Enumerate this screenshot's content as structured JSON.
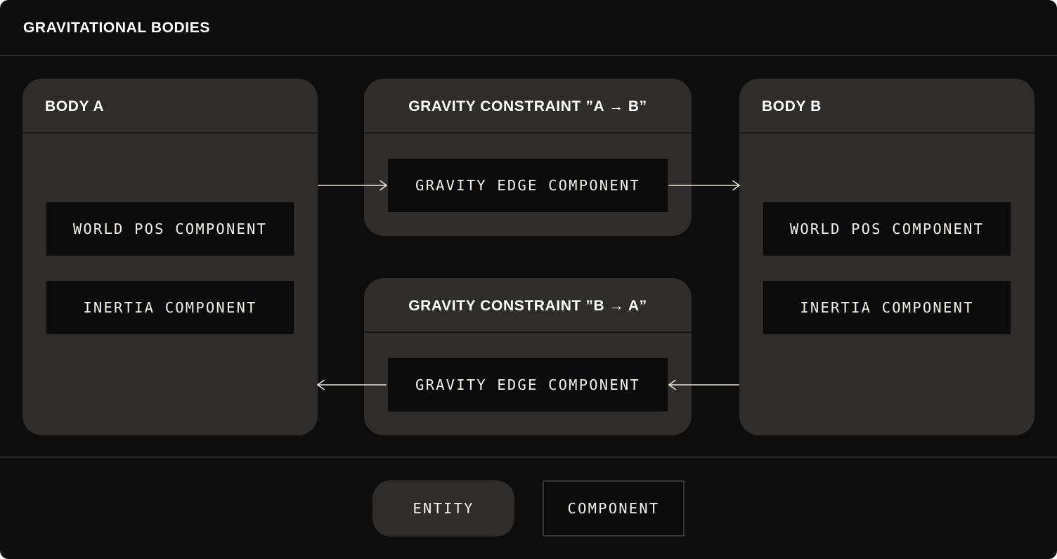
{
  "title": "GRAVITATIONAL BODIES",
  "colors": {
    "background": "#0d0d0d",
    "entity_fill": "#2e2d2c",
    "component_fill": "#0b0b0b",
    "text": "#f4f0e8",
    "arrow": "#ece4d6"
  },
  "entities": {
    "body_a": {
      "title": "BODY A",
      "components": [
        "WORLD POS COMPONENT",
        "INERTIA COMPONENT"
      ]
    },
    "constraint_ab": {
      "title": "GRAVITY CONSTRAINT ”A → B”",
      "components": [
        "GRAVITY EDGE COMPONENT"
      ]
    },
    "constraint_ba": {
      "title": "GRAVITY CONSTRAINT ”B → A”",
      "components": [
        "GRAVITY EDGE COMPONENT"
      ]
    },
    "body_b": {
      "title": "BODY B",
      "components": [
        "WORLD POS COMPONENT",
        "INERTIA COMPONENT"
      ]
    }
  },
  "connections": [
    {
      "from": "BODY A",
      "to": "GRAVITY EDGE COMPONENT (A → B)"
    },
    {
      "from": "GRAVITY EDGE COMPONENT (A → B)",
      "to": "BODY B"
    },
    {
      "from": "BODY B",
      "to": "GRAVITY EDGE COMPONENT (B → A)"
    },
    {
      "from": "GRAVITY EDGE COMPONENT (B → A)",
      "to": "BODY A"
    }
  ],
  "legend": {
    "entity": "ENTITY",
    "component": "COMPONENT"
  }
}
